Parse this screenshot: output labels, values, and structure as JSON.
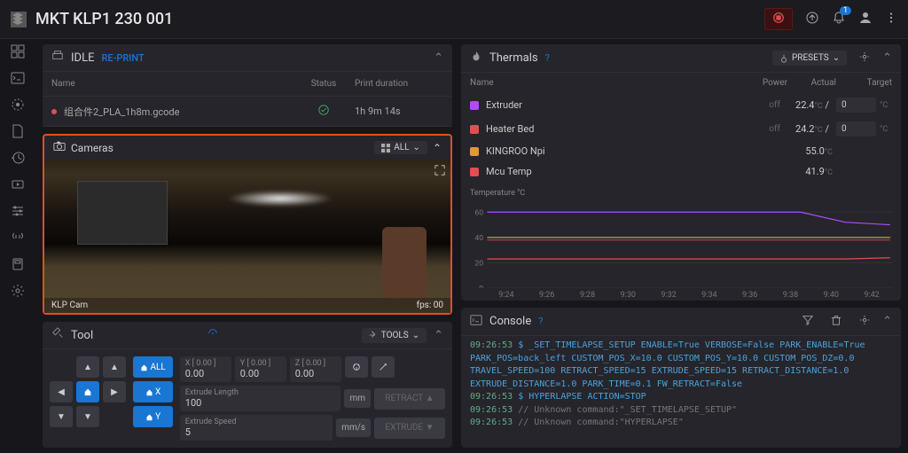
{
  "header": {
    "title": "MKT KLP1 230 001",
    "notifications_count": "1"
  },
  "sidebar_icons": [
    "dashboard",
    "console",
    "gcode",
    "files",
    "history",
    "timelapse",
    "tuning",
    "devtools",
    "machine",
    "settings"
  ],
  "status_panel": {
    "state": "IDLE",
    "reprint_label": "RE-PRINT",
    "col_name": "Name",
    "col_status": "Status",
    "col_duration": "Print duration",
    "job_name": "组合件2_PLA_1h8m.gcode",
    "job_duration": "1h 9m 14s"
  },
  "camera": {
    "title": "Cameras",
    "all_label": "ALL",
    "name": "KLP Cam",
    "fps": "fps: 00"
  },
  "tool": {
    "title": "Tool",
    "tools_btn": "TOOLS",
    "all": "ALL",
    "x": "X",
    "y": "Y",
    "coords": [
      {
        "label": "X [ 0.00 ]",
        "val": "0.00"
      },
      {
        "label": "Y [ 0.00 ]",
        "val": "0.00"
      },
      {
        "label": "Z [ 0.00 ]",
        "val": "0.00"
      }
    ],
    "extrude_len_label": "Extrude Length",
    "extrude_len": "100",
    "extrude_len_unit": "mm",
    "extrude_speed_label": "Extrude Speed",
    "extrude_speed": "5",
    "extrude_speed_unit": "mm/s",
    "retract_btn": "RETRACT",
    "extrude_btn": "EXTRUDE"
  },
  "thermals": {
    "title": "Thermals",
    "presets_label": "PRESETS",
    "col_name": "Name",
    "col_power": "Power",
    "col_actual": "Actual",
    "col_target": "Target",
    "rows": [
      {
        "swatch": "#b14aff",
        "name": "Extruder",
        "power": "off",
        "actual": "22.4",
        "unit": "°C",
        "target": "0",
        "has_target": true
      },
      {
        "swatch": "#e05050",
        "name": "Heater Bed",
        "power": "off",
        "actual": "24.2",
        "unit": "°C",
        "target": "0",
        "has_target": true
      },
      {
        "swatch": "#e09a30",
        "name": "KINGROO Npi",
        "power": "",
        "actual": "55.0",
        "unit": "°C",
        "target": "",
        "has_target": false
      },
      {
        "swatch": "#e05050",
        "name": "Mcu Temp",
        "power": "",
        "actual": "41.9",
        "unit": "°C",
        "target": "",
        "has_target": false
      }
    ],
    "chart_title": "Temperature °C"
  },
  "chart_data": {
    "type": "line",
    "x": [
      "9:24",
      "9:26",
      "9:28",
      "9:30",
      "9:32",
      "9:34",
      "9:36",
      "9:38",
      "9:40",
      "9:42"
    ],
    "ylim": [
      0,
      70
    ],
    "yticks": [
      0,
      20,
      40,
      60
    ],
    "series": [
      {
        "name": "Extruder",
        "color": "#b14aff",
        "values": [
          60,
          60,
          60,
          60,
          60,
          60,
          60,
          60,
          52,
          50
        ]
      },
      {
        "name": "Heater Bed",
        "color": "#e05050",
        "values": [
          23,
          23,
          23,
          23,
          23,
          23,
          23,
          23,
          23,
          24
        ]
      },
      {
        "name": "KINGROO Npi",
        "color": "#e09a30",
        "values": [
          40,
          40,
          40,
          40,
          40,
          40,
          40,
          40,
          40,
          40
        ]
      },
      {
        "name": "Mcu Temp",
        "color": "#b04040",
        "values": [
          38,
          38,
          38,
          38,
          38,
          38,
          38,
          38,
          38,
          38
        ]
      }
    ]
  },
  "console": {
    "title": "Console",
    "lines": [
      {
        "ts": "09:26:53",
        "kind": "cmd",
        "text": "$ _SET_TIMELAPSE_SETUP ENABLE=True VERBOSE=False PARK_ENABLE=True PARK_POS=back_left CUSTOM_POS_X=10.0 CUSTOM_POS_Y=10.0 CUSTOM_POS_DZ=0.0 TRAVEL_SPEED=100 RETRACT_SPEED=15 EXTRUDE_SPEED=15 RETRACT_DISTANCE=1.0 EXTRUDE_DISTANCE=1.0 PARK_TIME=0.1 FW_RETRACT=False"
      },
      {
        "ts": "09:26:53",
        "kind": "cmd",
        "text": "$ HYPERLAPSE ACTION=STOP"
      },
      {
        "ts": "09:26:53",
        "kind": "cm",
        "text": "// Unknown command:\"_SET_TIMELAPSE_SETUP\""
      },
      {
        "ts": "09:26:53",
        "kind": "cm",
        "text": "// Unknown command:\"HYPERLAPSE\""
      }
    ]
  }
}
